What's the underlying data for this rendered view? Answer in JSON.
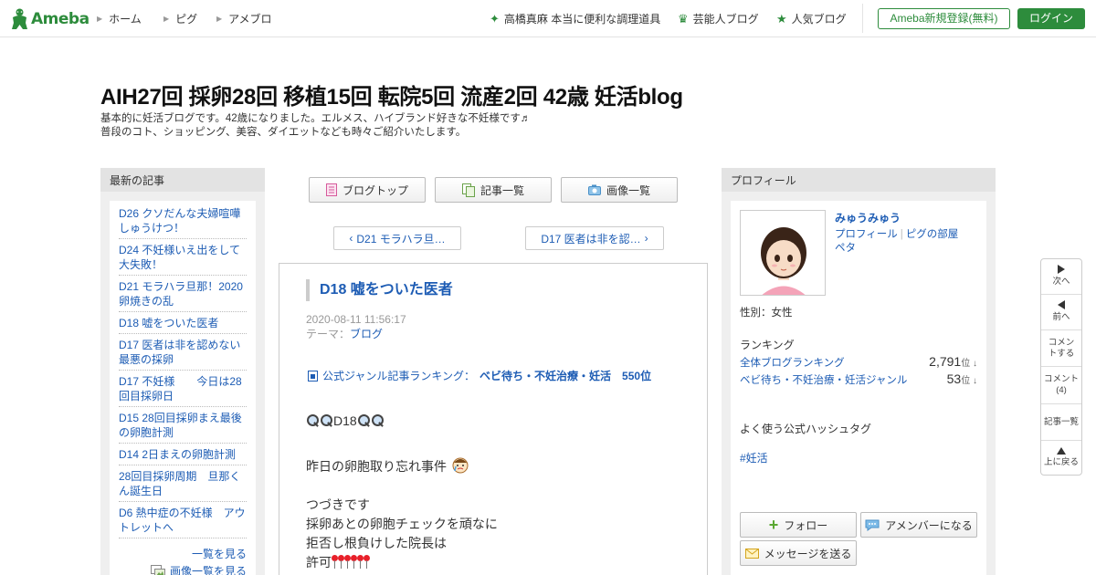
{
  "header": {
    "logo_text": "Ameba",
    "nav": [
      "ホーム",
      "ピグ",
      "アメブロ"
    ],
    "right_links": [
      "高橋真麻 本当に便利な調理道具",
      "芸能人ブログ",
      "人気ブログ"
    ],
    "register_label": "Ameba新規登録(無料)",
    "login_label": "ログイン"
  },
  "blog": {
    "title": "AIH27回 採卵28回 移植15回 転院5回 流産2回 42歳 妊活blog",
    "desc_line1": "基本的に妊活ブログです。42歳になりました。エルメス、ハイブランド好きな不妊様です♬",
    "desc_line2": "普段のコト、ショッピング、美容、ダイエットなども時々ご紹介いたします。"
  },
  "left_sidebar": {
    "heading": "最新の記事",
    "items": [
      "D26 クソだんな夫婦喧嘩しゅうけつ！",
      "D24 不妊様いえ出をして大失敗！",
      "D21 モラハラ旦那！2020卵焼きの乱",
      "D18 嘘をついた医者",
      "D17 医者は非を認めない　最悪の採卵",
      "D17 不妊様　　今日は28回目採卵日",
      "D15 28回目採卵まえ最後の卵胞計測",
      "D14 2日まえの卵胞計測",
      "28回目採卵周期　旦那くん誕生日",
      "D6 熱中症の不妊様　アウトレットへ"
    ],
    "more_label": "一覧を見る",
    "image_more_label": "画像一覧を見る"
  },
  "tabs": {
    "top": "ブログトップ",
    "list": "記事一覧",
    "images": "画像一覧"
  },
  "pager": {
    "prev": "D21 モラハラ旦…",
    "next": "D17 医者は非を認…"
  },
  "article": {
    "title": "D18 嘘をついた医者",
    "date": "2020-08-11 11:56:17",
    "theme_label": "テーマ：",
    "theme": "ブログ",
    "ranking_label": "公式ジャンル記事ランキング：",
    "ranking_value": "ベビ待ち・不妊治療・妊活　550位",
    "line1": "D18",
    "line2": "昨日の卵胞取り忘れ事件",
    "line3": "つづきです",
    "line4": "採卵あとの卵胞チェックを頑なに",
    "line5": "拒否し根負けした院長は",
    "line6": "許可"
  },
  "profile": {
    "heading": "プロフィール",
    "name": "みゅうみゅう",
    "link_profile": "プロフィール",
    "link_room": "ピグの部屋",
    "link_peta": "ペタ",
    "gender": "性別：女性",
    "ranking_heading": "ランキング",
    "rank1_label": "全体ブログランキング",
    "rank1_value": "2,791",
    "rank2_label": "ベビ待ち・不妊治療・妊活ジャンル",
    "rank2_value": "53",
    "rank_unit": "位",
    "hashtag_heading": "よく使う公式ハッシュタグ",
    "hashtag": "#妊活",
    "follow_label": "フォロー",
    "amember_label": "アメンバーになる",
    "message_label": "メッセージを送る"
  },
  "float_nav": {
    "next": "次へ",
    "prev": "前へ",
    "comment": "コメントする",
    "comments_line1": "コメント",
    "comments_count": "(4)",
    "list": "記事一覧",
    "top": "上に戻る"
  },
  "colors": {
    "brand_green": "#2d8c3c",
    "link_blue": "#1d5cb4"
  }
}
